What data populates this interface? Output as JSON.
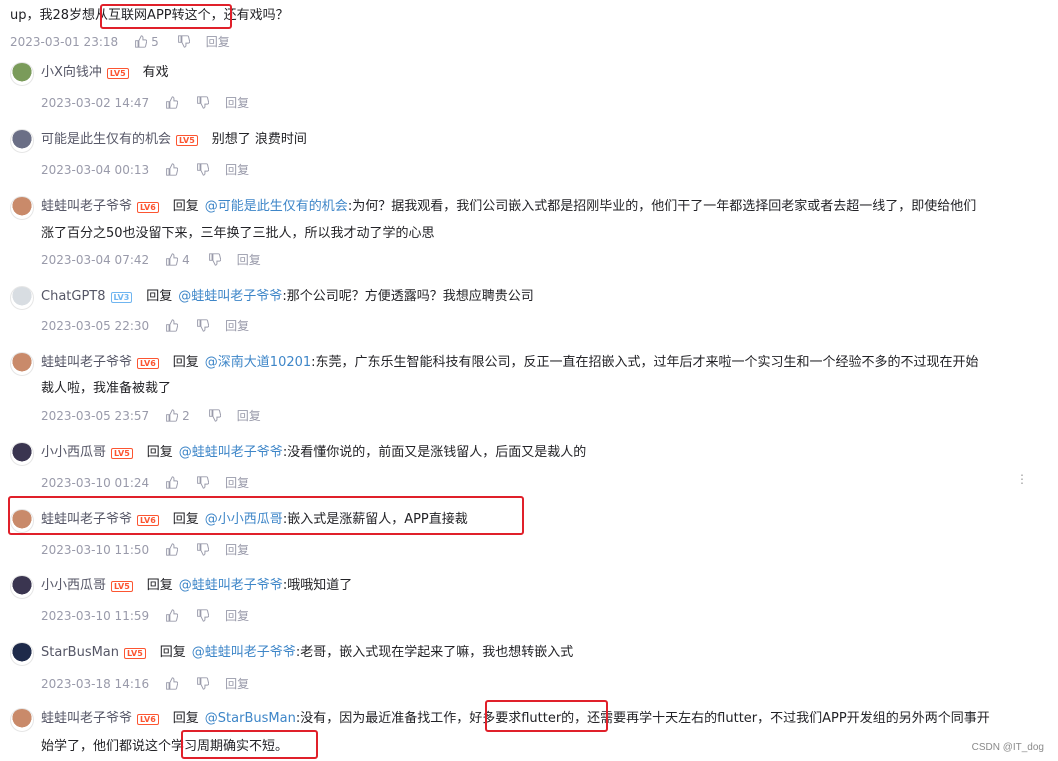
{
  "top": {
    "text_before": "up，我28岁想",
    "text_highlight": "从互联网APP转这个",
    "text_after": "，还有戏吗？",
    "date": "2023-03-01 23:18",
    "likes": "5",
    "reply_label": "回复"
  },
  "comments": [
    {
      "user": "小X向钱冲",
      "level": "LV5",
      "reply_to": "",
      "content": "有戏",
      "line2": "",
      "date": "2023-03-02 14:47",
      "likes": "",
      "reply_label": "回复"
    },
    {
      "user": "可能是此生仅有的机会",
      "level": "LV5",
      "reply_to": "",
      "content": "别想了 浪费时间",
      "line2": "",
      "date": "2023-03-04 00:13",
      "likes": "",
      "reply_label": "回复"
    },
    {
      "user": "蛙蛙叫老子爷爷",
      "level": "LV6",
      "reply_kw": "回复",
      "reply_to": "@可能是此生仅有的机会",
      "content": ":为何？据我观看，我们公司嵌入式都是招刚毕业的，他们干了一年都选择回老家或者去超一线了，即使给他们",
      "line2": "涨了百分之50也没留下来，三年换了三批人，所以我才动了学的心思",
      "date": "2023-03-04 07:42",
      "likes": "4",
      "reply_label": "回复"
    },
    {
      "user": "ChatGPT8",
      "level": "LV3",
      "reply_kw": "回复",
      "reply_to": "@蛙蛙叫老子爷爷",
      "content": ":那个公司呢？方便透露吗？我想应聘贵公司",
      "line2": "",
      "date": "2023-03-05 22:30",
      "likes": "",
      "reply_label": "回复"
    },
    {
      "user": "蛙蛙叫老子爷爷",
      "level": "LV6",
      "reply_kw": "回复",
      "reply_to": "@深南大道10201",
      "content": ":东莞，广东乐生智能科技有限公司，反正一直在招嵌入式，过年后才来啦一个实习生和一个经验不多的不过现在开始",
      "line2": "裁人啦，我准备被裁了",
      "date": "2023-03-05 23:57",
      "likes": "2",
      "reply_label": "回复"
    },
    {
      "user": "小小西瓜哥",
      "level": "LV5",
      "reply_kw": "回复",
      "reply_to": "@蛙蛙叫老子爷爷",
      "content": ":没看懂你说的，前面又是涨钱留人，后面又是裁人的",
      "line2": "",
      "date": "2023-03-10 01:24",
      "likes": "",
      "reply_label": "回复"
    },
    {
      "user": "蛙蛙叫老子爷爷",
      "level": "LV6",
      "reply_kw": "回复",
      "reply_to": "@小小西瓜哥",
      "content": ":嵌入式是涨薪留人，APP直接裁",
      "line2": "",
      "date": "2023-03-10 11:50",
      "likes": "",
      "reply_label": "回复"
    },
    {
      "user": "小小西瓜哥",
      "level": "LV5",
      "reply_kw": "回复",
      "reply_to": "@蛙蛙叫老子爷爷",
      "content": ":哦哦知道了",
      "line2": "",
      "date": "2023-03-10 11:59",
      "likes": "",
      "reply_label": "回复"
    },
    {
      "user": "StarBusMan",
      "level": "LV5",
      "reply_kw": "回复",
      "reply_to": "@蛙蛙叫老子爷爷",
      "content": ":老哥，嵌入式现在学起来了嘛，我也想转嵌入式",
      "line2": "",
      "date": "2023-03-18 14:16",
      "likes": "",
      "reply_label": "回复"
    },
    {
      "user": "蛙蛙叫老子爷爷",
      "level": "LV6",
      "reply_kw": "回复",
      "reply_to": "@StarBusMan",
      "content_a": ":没有，因为最近准备找工作，",
      "content_hl": "好多要求flutter的，",
      "content_b": "还需要再学十天左右的flutter，不过我们APP开发组的另外两个同事开",
      "line2_a": "始学了，他们都说这个",
      "line2_hl": "学习周期确实不短。"
    }
  ],
  "watermark": "CSDN @IT_dog",
  "more_icon": "⋮"
}
